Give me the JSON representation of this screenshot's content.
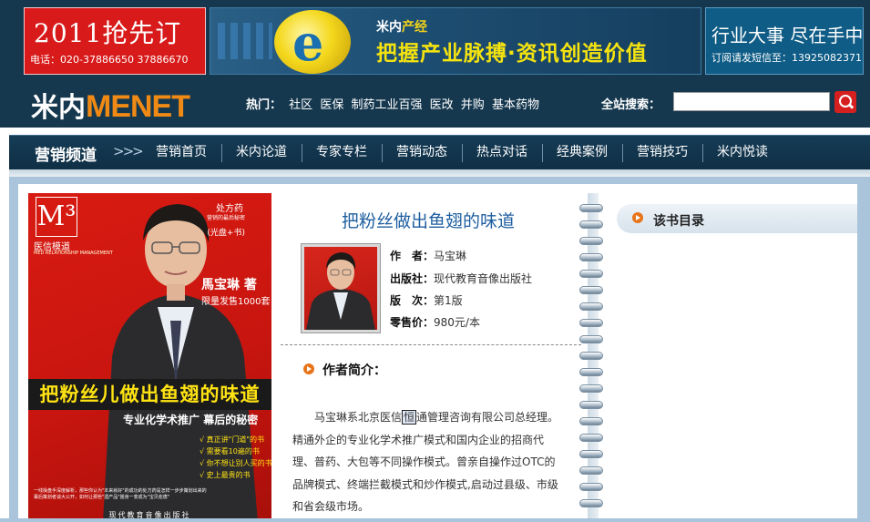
{
  "banner": {
    "left_ad": {
      "headline": "2011抢先订",
      "phone": "电话：020-37886650  37886670"
    },
    "mid_ad": {
      "brand_prefix": "米内",
      "brand_suffix": "产经",
      "slogan": "把握产业脉搏·资讯创造价值",
      "logo_letter": "e"
    },
    "right_ad": {
      "headline": "行业大事 尽在手中",
      "subtext": "订阅请发短信至：13925082371"
    }
  },
  "logo": {
    "cn": "米内",
    "en": "MENET"
  },
  "hot": {
    "label": "热门：",
    "links": [
      "社区",
      "医保",
      "制药工业百强",
      "医改",
      "并购",
      "基本药物"
    ]
  },
  "search": {
    "label": "全站搜索：",
    "placeholder": ""
  },
  "nav": {
    "title": "营销频道",
    "arrows": ">>>",
    "items": [
      "营销首页",
      "米内论道",
      "专家专栏",
      "营销动态",
      "热点对话",
      "经典案例",
      "营销技巧",
      "米内悦读"
    ]
  },
  "cover": {
    "m3": "M³",
    "series": "医信模道",
    "series_sub": "MED RELATIONSHIP MANAGEMENT",
    "rx_tag": "处方药",
    "rx_sub": "营销的最后秘密",
    "rx_bundle": "(光盘+书)",
    "author": "馬宝琳 著",
    "limited": "限量发售1000套",
    "title": "把粉丝儿做出鱼翅的味道",
    "tagline_a": "专业化学术推广",
    "tagline_b": "幕后的秘密",
    "points": [
      "√ 真正讲\"门道\"的书",
      "√ 需要看10遍的书",
      "√ 你不想让别人买的书",
      "√ 史上最贵的书"
    ],
    "bottom_text": "一线操盘手深度解析，那些你认为\"本来就好\"的成功的处方药是怎样一步步策划出来的",
    "bottom_text2": "幕后策划者谈大公开，如何让那些\"遗产品\"摇身一变成为\"宝贝疙瘩\"",
    "publisher": "现代教育音像出版社"
  },
  "book": {
    "title": "把粉丝做出鱼翅的味道",
    "author_label": "作　者：",
    "author": "马宝琳",
    "publisher_label": "出版社：",
    "publisher": "现代教育音像出版社",
    "edition_label": "版　次：",
    "edition": "第1版",
    "price_label": "零售价：",
    "price": "980元/本"
  },
  "intro": {
    "heading": "作者简介：",
    "lines": [
      "马宝琳系北京医信",
      "恒",
      "通管理咨询有限公司总经理。",
      "精通外企的专业化学术推广模式和国内企业的招商代",
      "理、普药、大包等不同操作模式。曾亲自操作过OTC的",
      "品牌模式、终端拦截模式和炒作模式,启动过县级、市级",
      "和省会级市场。"
    ]
  },
  "toc": {
    "title": "该书目录"
  },
  "icons": {
    "search": "search-icon",
    "bullet": "orange-arrow-bullet-icon",
    "ring": "binder-ring-icon"
  },
  "colors": {
    "header_bg": "#15384f",
    "accent_orange": "#f08a15",
    "title_blue": "#1f5fa0",
    "cover_red": "#d81b12"
  }
}
